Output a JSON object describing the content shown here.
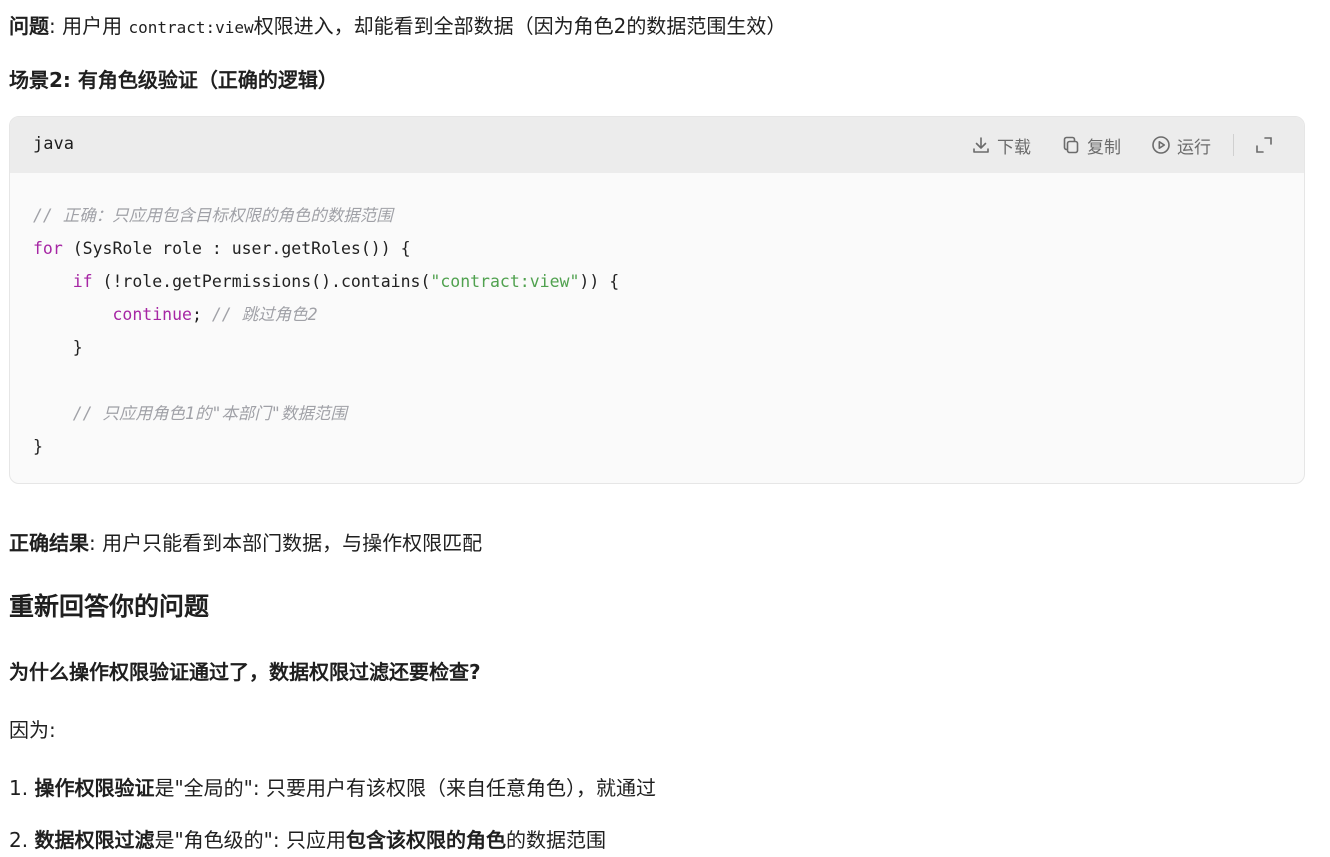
{
  "problem_line": {
    "label": "问题",
    "sep": ": 用户用 ",
    "code": "contract:view",
    "rest": "权限进入，却能看到全部数据（因为角色2的数据范围生效）"
  },
  "scene_line": {
    "prefix": "场景2: ",
    "bold": "有角色级验证（正确的逻辑）"
  },
  "code_block": {
    "language": "java",
    "toolbar": {
      "download_label": "下载",
      "copy_label": "复制",
      "run_label": "运行"
    },
    "lines": {
      "l1_comment": "// 正确：只应用包含目标权限的角色的数据范围",
      "l2_kw": "for",
      "l2_rest": " (SysRole role : user.getRoles()) {",
      "l3_indent": "    ",
      "l3_kw": "if",
      "l3_mid": " (!role.getPermissions().contains(",
      "l3_str": "\"contract:view\"",
      "l3_end": ")) {",
      "l4_indent": "        ",
      "l4_kw": "continue",
      "l4_mid": "; ",
      "l4_comment": "// 跳过角色2",
      "l5": "    }",
      "l6": "",
      "l7_indent": "    ",
      "l7_comment": "// 只应用角色1的\"本部门\"数据范围",
      "l8": "}"
    }
  },
  "result_line": {
    "label": "正确结果",
    "rest": ": 用户只能看到本部门数据，与操作权限匹配"
  },
  "section_heading": "重新回答你的问题",
  "question_heading": "为什么操作权限验证通过了，数据权限过滤还要检查?",
  "because": "因为:",
  "list": {
    "item1_num": "1. ",
    "item1_bold": "操作权限验证",
    "item1_rest": "是\"全局的\": 只要用户有该权限（来自任意角色），就通过",
    "item2_num": "2. ",
    "item2_bold": "数据权限过滤",
    "item2_mid": "是\"角色级的\": 只应用",
    "item2_bold2": "包含该权限的角色",
    "item2_rest": "的数据范围"
  }
}
